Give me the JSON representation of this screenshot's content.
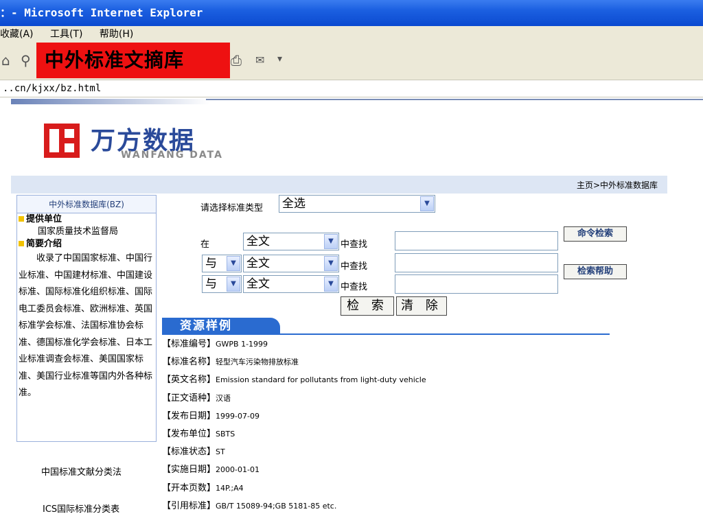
{
  "window": {
    "title": "：- Microsoft Internet Explorer"
  },
  "menu": {
    "items": [
      "收藏(A)",
      "工具(T)",
      "帮助(H)"
    ]
  },
  "banner": {
    "text": "中外标准文摘库"
  },
  "address": {
    "url": "..cn/kjxx/bz.html"
  },
  "logo": {
    "cn": "万方数据",
    "en": "WANFANG DATA",
    "color": "#d81c1c"
  },
  "breadcrumb": "主页>中外标准数据库",
  "sidebar": {
    "db_title": "中外标准数据库(BZ)",
    "provider_heading": "提供单位",
    "provider": "国家质量技术监督局",
    "intro_heading": "简要介绍",
    "intro": "收录了中国国家标准、中国行业标准、中国建材标准、中国建设标准、国际标准化组织标准、国际电工委员会标准、欧洲标准、英国标准学会标准、法国标准协会标准、德国标准化学会标准、日本工业标准调查会标准、美国国家标准、美国行业标准等国内外各种标准。",
    "links": [
      "中国标准文献分类法",
      "ICS国际标准分类表"
    ]
  },
  "form": {
    "type_label": "请选择标准类型",
    "type_value": "全选",
    "in_label": "在",
    "field_value": "全文",
    "logic_value": "与",
    "find_label": "中查找",
    "cmd_search": "命令检索",
    "search_help": "检索帮助",
    "search": "检 索",
    "clear": "清 除"
  },
  "sample": {
    "title": "资源样例",
    "rows": [
      {
        "k": "【标准编号】",
        "v": "GWPB 1-1999"
      },
      {
        "k": "【标准名称】",
        "v": "轻型汽车污染物排放标准"
      },
      {
        "k": "【英文名称】",
        "v": "Emission standard for pollutants from light-duty vehicle"
      },
      {
        "k": "【正文语种】",
        "v": "汉语"
      },
      {
        "k": "【发布日期】",
        "v": "1999-07-09"
      },
      {
        "k": "【发布单位】",
        "v": "SBTS"
      },
      {
        "k": "【标准状态】",
        "v": "ST"
      },
      {
        "k": "【实施日期】",
        "v": "2000-01-01"
      },
      {
        "k": "【开本页数】",
        "v": "14P.;A4"
      },
      {
        "k": "【引用标准】",
        "v": "GB/T 15089-94;GB 5181-85 etc."
      }
    ]
  }
}
